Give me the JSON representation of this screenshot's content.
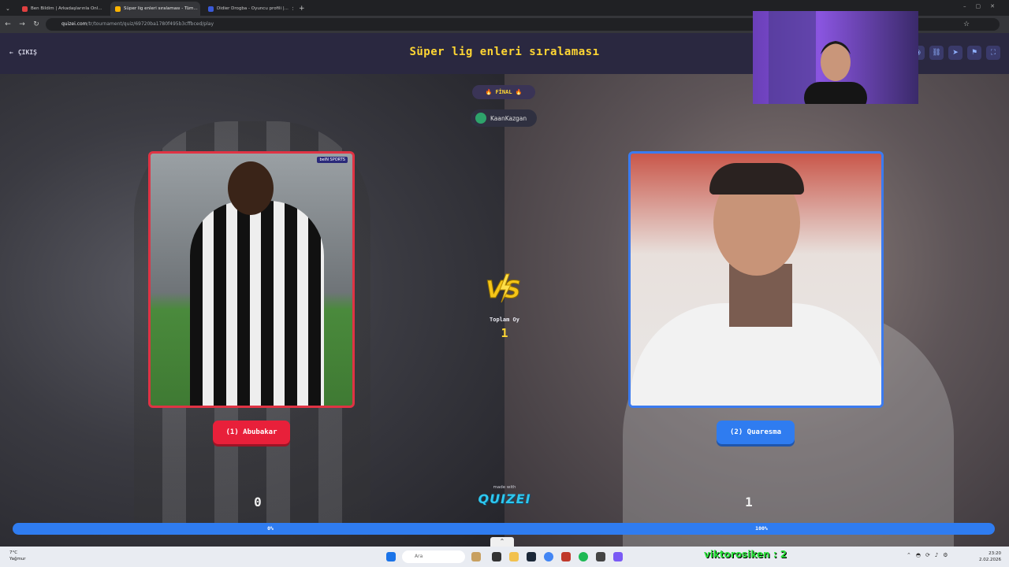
{
  "browser": {
    "tabs": [
      {
        "label": "Ben Bildim | Arkadaşlarınla Onl...",
        "active": false
      },
      {
        "label": "Süper lig enleri sıralaması - Tüm...",
        "active": true
      },
      {
        "label": "Didier Drogba - Oyuncu profili |...",
        "active": false
      }
    ],
    "url_host": "quizei.com",
    "url_path": "/tr/tournament/quiz/69720ba1780f495b3cffbced/play"
  },
  "header": {
    "exit_label": "ÇIKIŞ",
    "title": "Süper lig enleri sıralaması"
  },
  "stage": {
    "final_label": "🔥 FİNAL 🔥",
    "creator": "KaanKazgan"
  },
  "contestants": {
    "left": {
      "label": "(1) Abubakar",
      "score": "0",
      "percent_label": "0%",
      "percent": 0,
      "color": "#e8203a",
      "photo_text": "beIN SPORTS"
    },
    "right": {
      "label": "(2) Quaresma",
      "score": "1",
      "percent_label": "100%",
      "percent": 100,
      "color": "#2f7cf0"
    }
  },
  "total": {
    "label": "Toplam Oy",
    "value": "1"
  },
  "branding": {
    "made_with": "made with",
    "logo": "QUIZEI"
  },
  "taskbar": {
    "weather_temp": "7°C",
    "weather_desc": "Yağmur",
    "search_placeholder": "Ara",
    "time": "23:20",
    "date": "2.02.2026"
  },
  "overlay": {
    "subscriber_text": "viktorosiken : 2"
  }
}
